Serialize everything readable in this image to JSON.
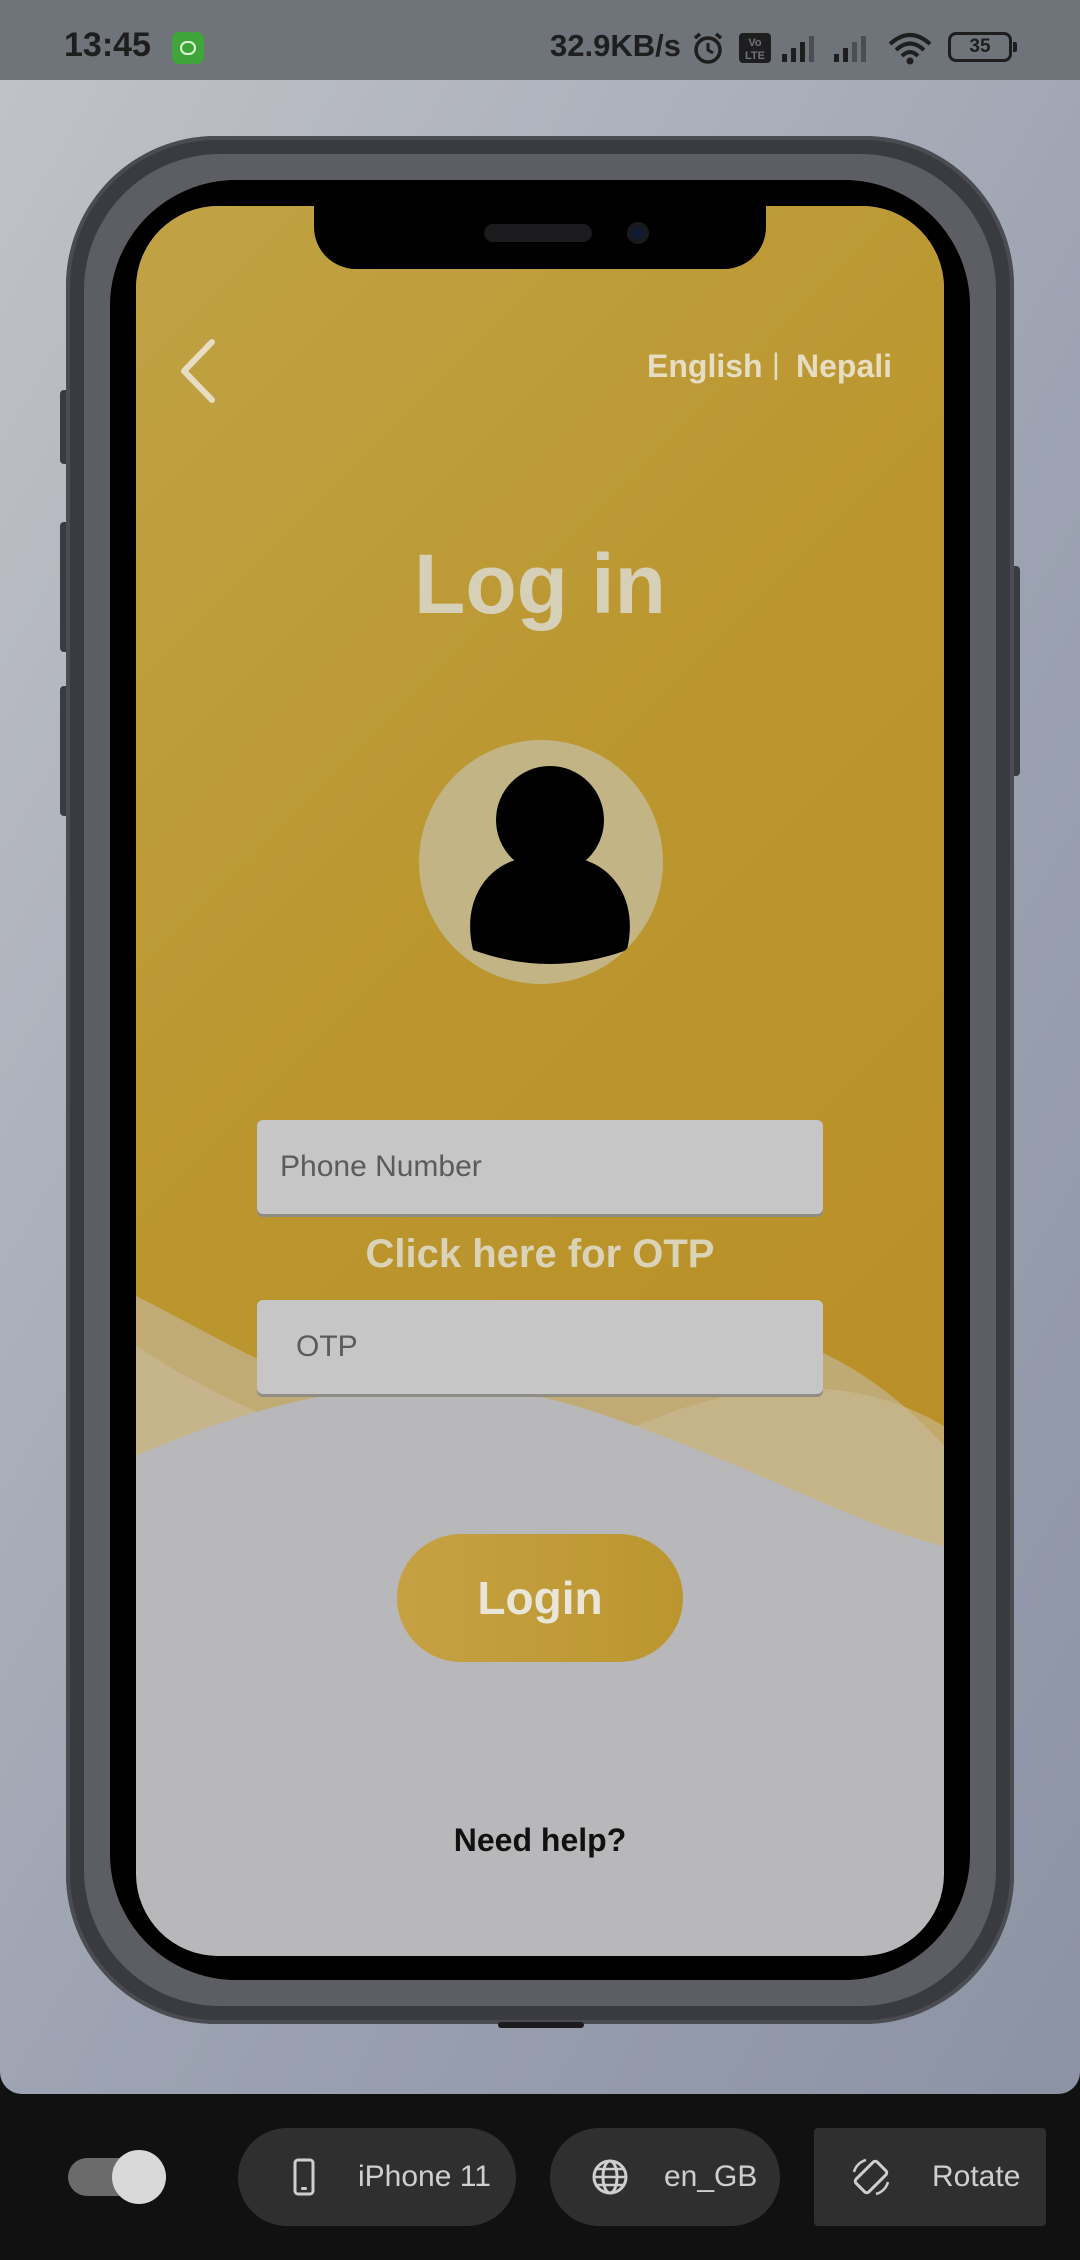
{
  "status_bar": {
    "time": "13:45",
    "net_speed": "32.9KB/s",
    "battery": "35",
    "volte": "Vo LTE"
  },
  "app": {
    "languages": [
      "English",
      "Nepali"
    ],
    "language_separator": "|",
    "title": "Log in",
    "phone_placeholder": "Phone Number",
    "otp_link": "Click here for OTP",
    "otp_placeholder": "OTP",
    "login_label": "Login",
    "help_label": "Need help?",
    "colors": {
      "accent": "#bb962e",
      "screen_bottom": "#b8b8ba",
      "avatar_bg": "#c2b484"
    }
  },
  "toolbar": {
    "device": "iPhone 11",
    "locale": "en_GB",
    "rotate": "Rotate",
    "toggle_on": true
  }
}
